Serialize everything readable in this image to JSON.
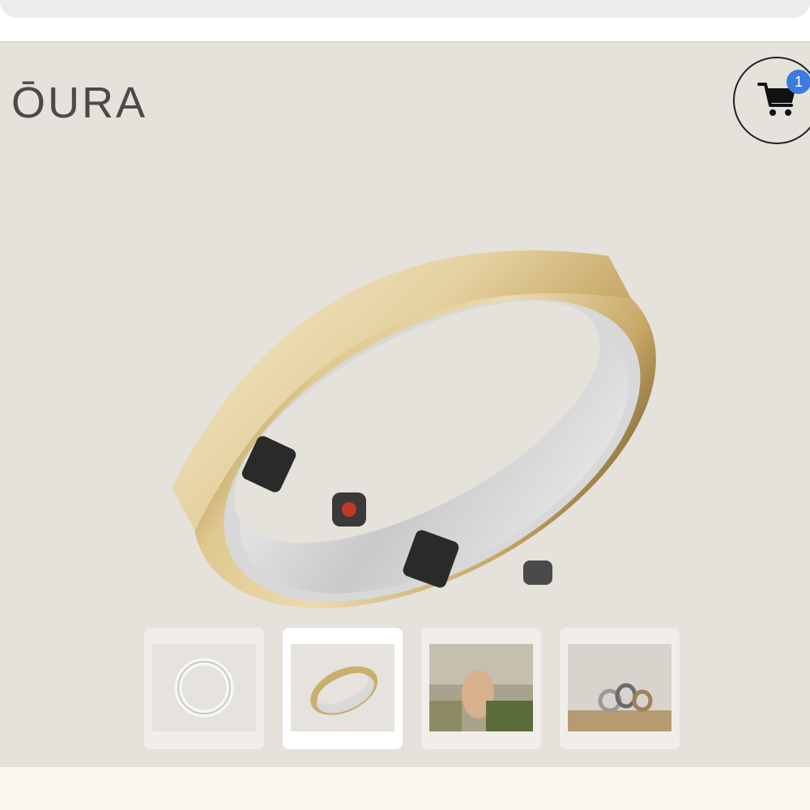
{
  "header": {
    "logo_text": "ŌURA"
  },
  "cart": {
    "icon": "shopping-cart-icon",
    "badge_count": "1",
    "badge_color": "#3a7bdc"
  },
  "product": {
    "hero_image": "gold-ring-hero",
    "ring_color": "#c9ae6c"
  },
  "gallery": {
    "selected_index": 1,
    "thumbnails": [
      {
        "image": "silver-ring-topdown"
      },
      {
        "image": "gold-ring-angled"
      },
      {
        "image": "hand-with-plants"
      },
      {
        "image": "rings-on-shelf"
      }
    ]
  }
}
